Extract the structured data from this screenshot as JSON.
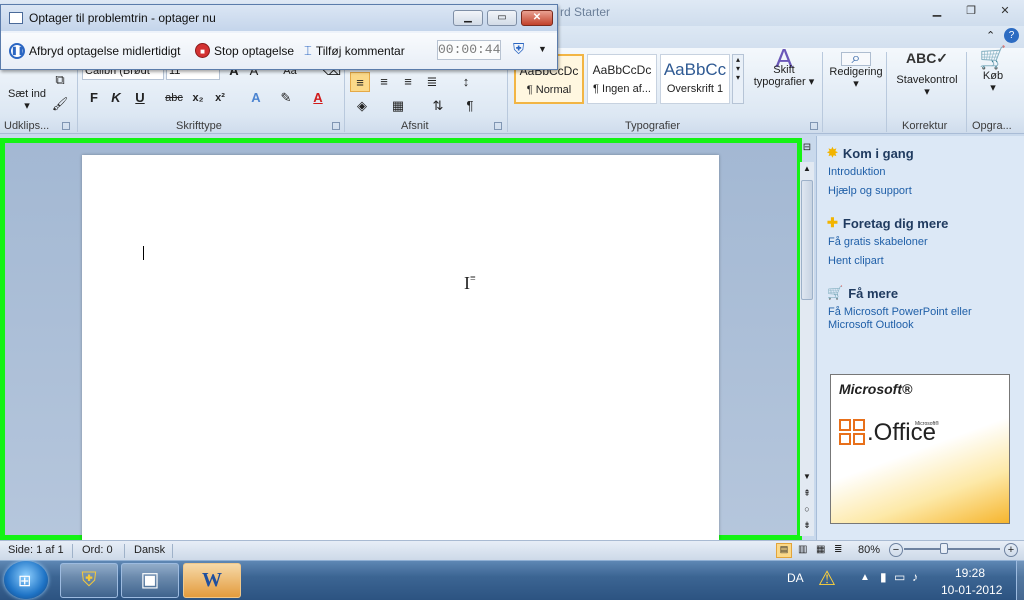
{
  "word": {
    "title": "rd Starter",
    "ribbon": {
      "clipboard": {
        "paste_label": "Sæt ind",
        "group_label": "Udklips..."
      },
      "font": {
        "font_name": "Calibri (Brødt",
        "font_size": "11",
        "group_label": "Skrifttype",
        "bold": "F",
        "italic": "K",
        "underline": "U",
        "strike": "abc",
        "subscript": "x₂",
        "superscript": "x²"
      },
      "paragraph": {
        "group_label": "Afsnit"
      },
      "styles": {
        "group_label": "Typografier",
        "items": [
          {
            "sample": "AaBbCcDc",
            "name": "¶ Normal"
          },
          {
            "sample": "AaBbCcDc",
            "name": "¶ Ingen af..."
          },
          {
            "sample": "AaBbCc",
            "name": "Overskrift 1"
          }
        ],
        "change_styles_label": "Skift typografier"
      },
      "editing": {
        "label": "Redigering"
      },
      "proofing": {
        "label": "Stavekontrol",
        "group_label": "Korrektur"
      },
      "buy": {
        "label": "Køb",
        "group_label": "Opgra..."
      }
    },
    "task_pane": {
      "sections": [
        {
          "heading": "Kom i gang",
          "icon": "star-icon",
          "links": [
            "Introduktion",
            "Hjælp og support"
          ]
        },
        {
          "heading": "Foretag dig mere",
          "icon": "plus-icon",
          "links": [
            "Få gratis skabeloner",
            "Hent clipart"
          ]
        },
        {
          "heading": "Få mere",
          "icon": "cart-icon",
          "links": [
            "Få Microsoft PowerPoint eller Microsoft Outlook"
          ]
        }
      ],
      "ad": {
        "brand": "Microsoft",
        "product": "Office",
        "sup": "Microsoft®"
      }
    },
    "status_bar": {
      "page": "Side: 1 af 1",
      "words": "Ord: 0",
      "language": "Dansk",
      "zoom": "80%"
    }
  },
  "recorder": {
    "title": "Optager til problemtrin - optager nu",
    "pause_label": "Afbryd optagelse midlertidigt",
    "stop_label": "Stop optagelse",
    "comment_label": "Tilføj kommentar",
    "timer": "00:00:44"
  },
  "taskbar": {
    "language": "DA",
    "time": "19:28",
    "date": "10-01-2012"
  }
}
